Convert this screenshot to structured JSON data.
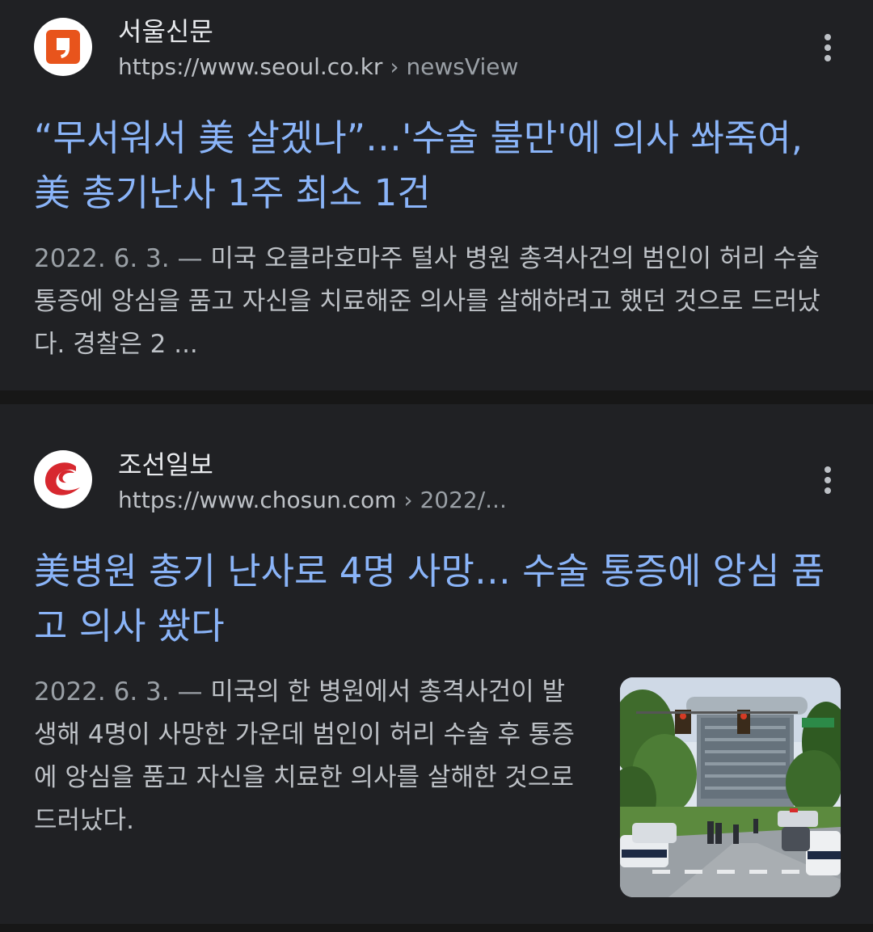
{
  "results": [
    {
      "site_name": "서울신문",
      "url_domain": "https://www.seoul.co.kr",
      "url_sep": " › ",
      "url_path": "newsView",
      "title": "“무서워서 美 살겠나”…'수술 불만'에 의사 쏴죽여, 美 총기난사 1주 최소 1건",
      "date": "2022. 6. 3.",
      "dash": " — ",
      "snippet": "미국 오클라호마주 털사 병원 총격사건의 범인이 허리 수술 통증에 앙심을 품고 자신을 치료해준 의사를 살해하려고 했던 것으로 드러났다. 경찰은 2 ...",
      "favicon": "seoul-shinmun-logo",
      "favicon_color": "#e8541c"
    },
    {
      "site_name": "조선일보",
      "url_domain": "https://www.chosun.com",
      "url_sep": " › ",
      "url_path": "2022/...",
      "title": "美병원 총기 난사로 4명 사망… 수술 통증에 앙심 품고 의사 쐈다",
      "date": "2022. 6. 3.",
      "dash": " — ",
      "snippet": "미국의 한 병원에서 총격사건이 발생해 4명이 사망한 가운데 범인이 허리 수술 후 통증에 앙심을 품고 자신을 치료한 의사를 살해한 것으로 드러났다.",
      "favicon": "chosun-ilbo-logo",
      "favicon_color": "#d7282f",
      "thumbnail": "hospital-shooting-scene-photo"
    }
  ],
  "colors": {
    "background": "#202124",
    "title_link": "#8ab4f8",
    "text": "#bdc1c6",
    "separator": "#171717"
  }
}
